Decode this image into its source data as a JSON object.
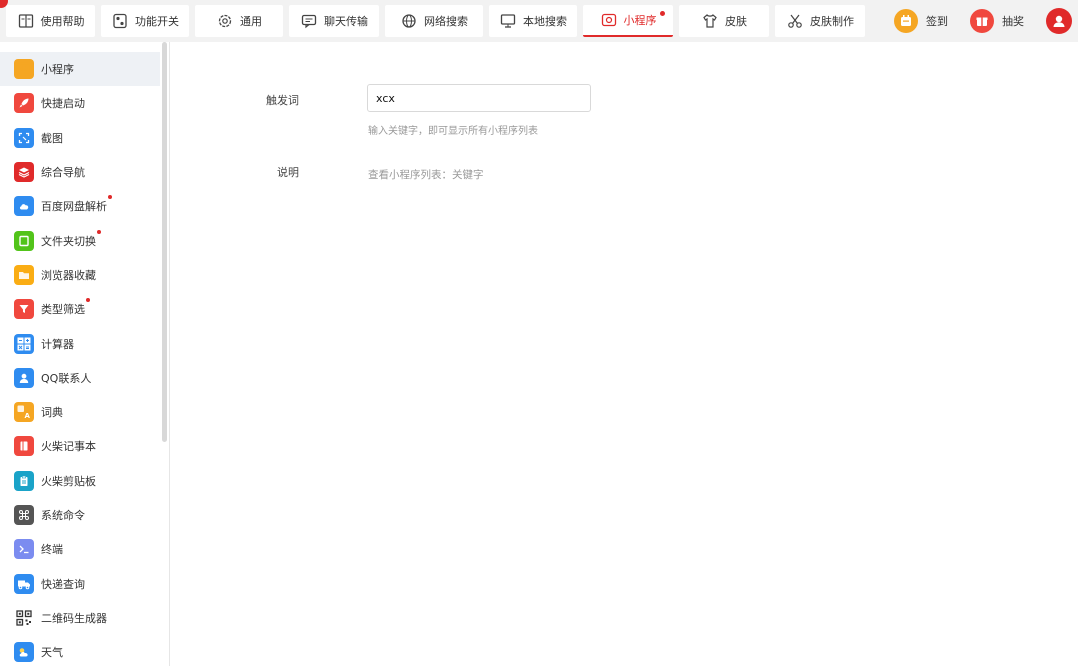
{
  "colors": {
    "accent": "#e02a2a",
    "topbar_bg": "#f2f2f2",
    "sidebar_active_bg": "#eef1f5",
    "hint_text": "#999999"
  },
  "tabs": [
    {
      "label": "使用帮助",
      "icon": "help-book-icon",
      "active": false,
      "dot": false
    },
    {
      "label": "功能开关",
      "icon": "switch-icon",
      "active": false,
      "dot": false
    },
    {
      "label": "通用",
      "icon": "gear-icon",
      "active": false,
      "dot": false
    },
    {
      "label": "聊天传输",
      "icon": "chat-icon",
      "active": false,
      "dot": false
    },
    {
      "label": "网络搜索",
      "icon": "globe-icon",
      "active": false,
      "dot": false
    },
    {
      "label": "本地搜索",
      "icon": "monitor-icon",
      "active": false,
      "dot": false
    },
    {
      "label": "小程序",
      "icon": "mini-program-icon",
      "active": true,
      "dot": true
    },
    {
      "label": "皮肤",
      "icon": "tshirt-icon",
      "active": false,
      "dot": false
    },
    {
      "label": "皮肤制作",
      "icon": "scissors-icon",
      "active": false,
      "dot": false
    }
  ],
  "actions": {
    "signin_label": "签到",
    "lottery_label": "抽奖"
  },
  "sidebar": {
    "items": [
      {
        "label": "小程序",
        "icon": "mini-program-icon",
        "color": "#f5a623",
        "active": true,
        "dot": false
      },
      {
        "label": "快捷启动",
        "icon": "rocket-icon",
        "color": "#f0483e",
        "active": false,
        "dot": false
      },
      {
        "label": "截图",
        "icon": "screenshot-icon",
        "color": "#2f8cf0",
        "active": false,
        "dot": false
      },
      {
        "label": "综合导航",
        "icon": "layers-icon",
        "color": "#e02a2a",
        "active": false,
        "dot": false
      },
      {
        "label": "百度网盘解析",
        "icon": "cloud-icon",
        "color": "#2f8cf0",
        "active": false,
        "dot": true
      },
      {
        "label": "文件夹切换",
        "icon": "folder-switch-icon",
        "color": "#52c41a",
        "active": false,
        "dot": true
      },
      {
        "label": "浏览器收藏",
        "icon": "folder-icon",
        "color": "#faad14",
        "active": false,
        "dot": false
      },
      {
        "label": "类型筛选",
        "icon": "filter-icon",
        "color": "#f0483e",
        "active": false,
        "dot": true
      },
      {
        "label": "计算器",
        "icon": "calculator-icon",
        "color": "#2f8cf0",
        "active": false,
        "dot": false
      },
      {
        "label": "QQ联系人",
        "icon": "qq-contact-icon",
        "color": "#2f8cf0",
        "active": false,
        "dot": false
      },
      {
        "label": "词典",
        "icon": "dictionary-icon",
        "color": "#f5a623",
        "active": false,
        "dot": false
      },
      {
        "label": "火柴记事本",
        "icon": "notebook-icon",
        "color": "#f0483e",
        "active": false,
        "dot": false
      },
      {
        "label": "火柴剪贴板",
        "icon": "clipboard-icon",
        "color": "#1aa3c8",
        "active": false,
        "dot": false
      },
      {
        "label": "系统命令",
        "icon": "command-icon",
        "color": "#555555",
        "active": false,
        "dot": false
      },
      {
        "label": "终端",
        "icon": "terminal-icon",
        "color": "#7b8cf0",
        "active": false,
        "dot": false
      },
      {
        "label": "快递查询",
        "icon": "delivery-truck-icon",
        "color": "#2f8cf0",
        "active": false,
        "dot": false
      },
      {
        "label": "二维码生成器",
        "icon": "qrcode-icon",
        "color": "#333333",
        "active": false,
        "dot": false
      },
      {
        "label": "天气",
        "icon": "weather-icon",
        "color": "#2f8cf0",
        "active": false,
        "dot": false
      }
    ]
  },
  "main": {
    "trigger_label": "触发词",
    "trigger_value": "xcx",
    "trigger_hint": "输入关键字，即可显示所有小程序列表",
    "desc_label": "说明",
    "desc_text": "查看小程序列表：关键字"
  }
}
